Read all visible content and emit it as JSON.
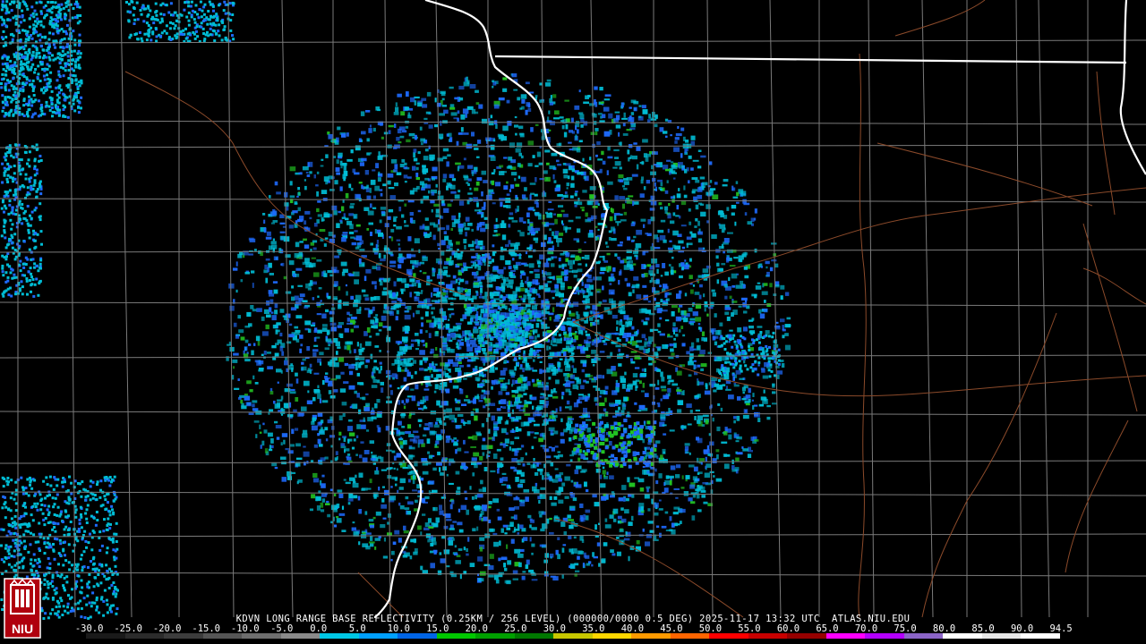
{
  "radar": {
    "caption": "KDVN LONG RANGE BASE REFLECTIVITY (0.25KM / 256 LEVEL) (000000/0000 0.5 DEG) 2025-11-17 13:32 UTC  ATLAS.NIU.EDU",
    "logo_text": "NIU",
    "scale_labels": [
      "-30.0",
      "-25.0",
      "-20.0",
      "-15.0",
      "-10.0",
      "-5.0",
      "0.0",
      "5.0",
      "10.0",
      "15.0",
      "20.0",
      "25.0",
      "30.0",
      "35.0",
      "40.0",
      "45.0",
      "50.0",
      "55.0",
      "60.0",
      "65.0",
      "70.0",
      "75.0",
      "80.0",
      "85.0",
      "90.0",
      "94.5"
    ],
    "scale_colors": [
      "#1a1a1a",
      "#2b2b2b",
      "#3c3c3c",
      "#555555",
      "#6e6e6e",
      "#8a8a8a",
      "#00c8e6",
      "#00a0ff",
      "#0064e6",
      "#00c800",
      "#00a000",
      "#007800",
      "#c8c800",
      "#ffd700",
      "#ff9a00",
      "#ff6400",
      "#ff0000",
      "#c80000",
      "#960000",
      "#ff00ff",
      "#b400ff",
      "#8c64c8",
      "#ffffff",
      "#e6e6e6",
      "#ffffff"
    ],
    "colors": {
      "background": "#000000",
      "county_lines": "#7a7a7a",
      "state_lines": "#ffffff",
      "highways": "#8b4a2a",
      "echo_light": "#00bcd4",
      "echo_medium": "#1e6bff",
      "echo_strong": "#22c322"
    }
  }
}
